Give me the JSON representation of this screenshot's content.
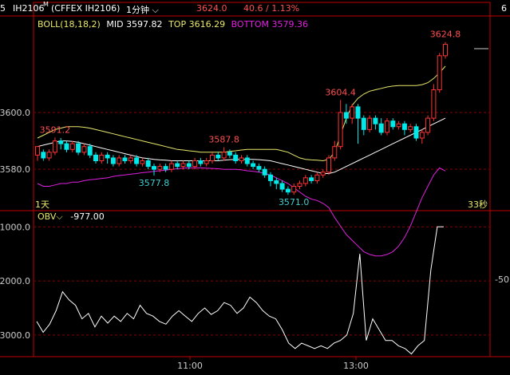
{
  "header": {
    "left_fragment": "5",
    "code": "IH2106",
    "superscript": "M",
    "exchange_label": "(CFFEX IH2106)",
    "period": "1分钟",
    "price": "3624.0",
    "change": "40.6 / 1.13%",
    "right_fragment": "6"
  },
  "boll": {
    "name": "BOLL(18,18,2)",
    "mid_label": "MID",
    "mid_value": "3597.82",
    "top_label": "TOP",
    "top_value": "3616.29",
    "bottom_label": "BOTTOM",
    "bottom_value": "3579.36"
  },
  "obv": {
    "name": "OBV",
    "value": "-977.00"
  },
  "markers": {
    "left_day": "1天",
    "right_seconds": "33秒",
    "right_fragment": "-50"
  },
  "colors": {
    "background": "#000000",
    "up": "#ff3232",
    "down": "#00e8e8",
    "mid_line": "#ffffff",
    "top_line": "#e8e86a",
    "bottom_line": "#e020e0",
    "grid": "#8b0000",
    "axis": "#c00000",
    "obv_line": "#ffffff",
    "price_label": "#ff5050",
    "low_label": "#40d0d0"
  },
  "chart_data": [
    {
      "type": "candlestick",
      "title": "IH2106 1分钟",
      "ylim": [
        3566,
        3634
      ],
      "y_ticks": [
        3580.0,
        3600.0
      ],
      "x_ticks": [
        "11:00",
        "13:00"
      ],
      "series": [
        {
          "name": "MID",
          "values": [
            3588.0,
            3588.5,
            3589.0,
            3589.5,
            3590.0,
            3590.0,
            3589.8,
            3589.5,
            3589.0,
            3588.5,
            3588.0,
            3587.5,
            3587.0,
            3586.5,
            3586.0,
            3585.5,
            3585.0,
            3584.5,
            3584.0,
            3583.8,
            3583.5,
            3583.3,
            3583.2,
            3583.0,
            3583.0,
            3583.0,
            3583.0,
            3583.0,
            3583.0,
            3583.0,
            3583.0,
            3583.0,
            3583.2,
            3583.4,
            3583.5,
            3583.5,
            3583.5,
            3583.5,
            3583.4,
            3583.2,
            3583.0,
            3582.5,
            3582.0,
            3581.5,
            3581.0,
            3580.5,
            3580.0,
            3579.5,
            3579.0,
            3578.5,
            3578.5,
            3579.0,
            3580.0,
            3581.0,
            3582.0,
            3583.0,
            3584.0,
            3585.0,
            3586.0,
            3587.0,
            3588.0,
            3589.0,
            3590.0,
            3591.0,
            3592.0,
            3593.0,
            3594.0,
            3595.0,
            3596.0,
            3597.0,
            3598.0
          ]
        },
        {
          "name": "TOP",
          "values": [
            3591.0,
            3592.0,
            3593.0,
            3594.0,
            3594.5,
            3595.0,
            3595.0,
            3595.0,
            3594.8,
            3594.5,
            3594.0,
            3593.5,
            3593.0,
            3592.5,
            3592.0,
            3591.5,
            3591.0,
            3590.5,
            3590.0,
            3589.5,
            3589.0,
            3588.5,
            3588.0,
            3587.5,
            3587.0,
            3586.8,
            3586.5,
            3586.3,
            3586.0,
            3586.0,
            3586.0,
            3586.0,
            3586.0,
            3586.3,
            3586.5,
            3586.8,
            3587.0,
            3587.0,
            3587.0,
            3587.0,
            3587.0,
            3587.0,
            3586.5,
            3586.0,
            3585.0,
            3584.0,
            3583.5,
            3583.3,
            3583.2,
            3583.0,
            3583.5,
            3586.0,
            3592.0,
            3598.0,
            3602.5,
            3605.0,
            3606.5,
            3607.5,
            3608.0,
            3608.5,
            3609.0,
            3609.3,
            3609.5,
            3609.5,
            3609.5,
            3609.5,
            3609.8,
            3610.5,
            3612.0,
            3614.0,
            3616.3
          ]
        },
        {
          "name": "BOTTOM",
          "values": [
            3575.0,
            3574.0,
            3574.0,
            3574.5,
            3575.0,
            3575.0,
            3575.5,
            3575.5,
            3576.0,
            3576.3,
            3576.5,
            3576.8,
            3577.0,
            3577.5,
            3577.8,
            3578.0,
            3578.3,
            3578.5,
            3578.8,
            3579.0,
            3579.3,
            3579.5,
            3579.7,
            3580.0,
            3580.2,
            3580.4,
            3580.5,
            3580.5,
            3580.5,
            3580.4,
            3580.3,
            3580.2,
            3580.0,
            3580.0,
            3580.0,
            3579.8,
            3579.5,
            3579.3,
            3579.0,
            3578.5,
            3578.0,
            3577.0,
            3576.0,
            3575.0,
            3573.5,
            3572.0,
            3570.5,
            3569.5,
            3569.0,
            3568.0,
            3566.5,
            3563.0,
            3560.0,
            3557.0,
            3555.0,
            3553.0,
            3551.0,
            3550.0,
            3549.5,
            3549.5,
            3550.0,
            3551.0,
            3553.0,
            3556.0,
            3560.0,
            3565.0,
            3570.0,
            3574.0,
            3578.0,
            3580.5,
            3579.4
          ]
        }
      ],
      "candles": [
        [
          3585,
          3588,
          3583,
          3586
        ],
        [
          3586,
          3584,
          3583,
          3587
        ],
        [
          3584,
          3586,
          3583,
          3587
        ],
        [
          3586,
          3590,
          3585,
          3591.2
        ],
        [
          3590,
          3589,
          3587,
          3591
        ],
        [
          3589,
          3587,
          3586,
          3590
        ],
        [
          3587,
          3589,
          3586,
          3590
        ],
        [
          3589,
          3586,
          3585,
          3590
        ],
        [
          3586,
          3588,
          3585,
          3589
        ],
        [
          3588,
          3585,
          3584,
          3589
        ],
        [
          3585,
          3583,
          3582,
          3586
        ],
        [
          3583,
          3585,
          3582,
          3586
        ],
        [
          3585,
          3584,
          3582,
          3586
        ],
        [
          3584,
          3582,
          3581,
          3585
        ],
        [
          3582,
          3584,
          3581,
          3585
        ],
        [
          3584,
          3583,
          3582,
          3585
        ],
        [
          3583,
          3584,
          3582,
          3585
        ],
        [
          3584,
          3582,
          3581,
          3585
        ],
        [
          3582,
          3583,
          3581,
          3584
        ],
        [
          3583,
          3581,
          3580,
          3584
        ],
        [
          3581,
          3580,
          3577.8,
          3582
        ],
        [
          3580,
          3581,
          3579,
          3582
        ],
        [
          3581,
          3580,
          3579,
          3582
        ],
        [
          3580,
          3582,
          3579,
          3583
        ],
        [
          3582,
          3581,
          3580,
          3583
        ],
        [
          3581,
          3582,
          3580,
          3583
        ],
        [
          3582,
          3581,
          3580,
          3583
        ],
        [
          3581,
          3583,
          3580,
          3584
        ],
        [
          3583,
          3582,
          3581,
          3584
        ],
        [
          3582,
          3583,
          3581,
          3584
        ],
        [
          3583,
          3585,
          3582,
          3586
        ],
        [
          3585,
          3584,
          3583,
          3586
        ],
        [
          3584,
          3586,
          3583,
          3587.8
        ],
        [
          3586,
          3585,
          3584,
          3587
        ],
        [
          3585,
          3583,
          3582,
          3586
        ],
        [
          3583,
          3584,
          3582,
          3585
        ],
        [
          3584,
          3582,
          3581,
          3585
        ],
        [
          3582,
          3581,
          3580,
          3583
        ],
        [
          3581,
          3580,
          3579,
          3582
        ],
        [
          3580,
          3578,
          3577,
          3581
        ],
        [
          3578,
          3576,
          3574,
          3579
        ],
        [
          3576,
          3575,
          3573,
          3577
        ],
        [
          3575,
          3573,
          3572,
          3576
        ],
        [
          3573,
          3572,
          3571.0,
          3574
        ],
        [
          3572,
          3574,
          3571,
          3575
        ],
        [
          3574,
          3575,
          3573,
          3576
        ],
        [
          3575,
          3577,
          3574,
          3578
        ],
        [
          3577,
          3576,
          3575,
          3578
        ],
        [
          3576,
          3578,
          3575,
          3579
        ],
        [
          3578,
          3579,
          3577,
          3580
        ],
        [
          3579,
          3584,
          3578,
          3585
        ],
        [
          3584,
          3588,
          3583,
          3590
        ],
        [
          3588,
          3600,
          3587,
          3604.4
        ],
        [
          3600,
          3598,
          3596,
          3603
        ],
        [
          3598,
          3602,
          3596,
          3603
        ],
        [
          3602,
          3598,
          3589,
          3603
        ],
        [
          3598,
          3594,
          3592,
          3599
        ],
        [
          3594,
          3598,
          3593,
          3599
        ],
        [
          3598,
          3596,
          3594,
          3599
        ],
        [
          3596,
          3593,
          3592,
          3598
        ],
        [
          3593,
          3597,
          3592,
          3598
        ],
        [
          3597,
          3595,
          3594,
          3598
        ],
        [
          3595,
          3596,
          3594,
          3597
        ],
        [
          3596,
          3594,
          3592,
          3597
        ],
        [
          3594,
          3595,
          3593,
          3596
        ],
        [
          3595,
          3591,
          3590,
          3596
        ],
        [
          3591,
          3593,
          3589,
          3594
        ],
        [
          3593,
          3598,
          3592,
          3599
        ],
        [
          3598,
          3608,
          3597,
          3610
        ],
        [
          3608,
          3620,
          3607,
          3621
        ],
        [
          3620,
          3624,
          3619,
          3624.8
        ]
      ],
      "annotations": [
        {
          "text": "3591.2",
          "value": 3591.2,
          "kind": "high"
        },
        {
          "text": "3577.8",
          "value": 3577.8,
          "kind": "low"
        },
        {
          "text": "3587.8",
          "value": 3587.8,
          "kind": "high"
        },
        {
          "text": "3571.0",
          "value": 3571.0,
          "kind": "low"
        },
        {
          "text": "3604.4",
          "value": 3604.4,
          "kind": "high"
        },
        {
          "text": "3624.8",
          "value": 3624.8,
          "kind": "high"
        }
      ]
    },
    {
      "type": "line",
      "title": "OBV",
      "ylim": [
        -3400,
        -700
      ],
      "y_ticks": [
        -1000.0,
        -2000.0,
        -3000.0
      ],
      "series": [
        {
          "name": "OBV",
          "values": [
            -2750,
            -2950,
            -2800,
            -2550,
            -2200,
            -2350,
            -2450,
            -2700,
            -2600,
            -2850,
            -2650,
            -2780,
            -2650,
            -2750,
            -2600,
            -2700,
            -2450,
            -2600,
            -2650,
            -2750,
            -2800,
            -2650,
            -2550,
            -2650,
            -2750,
            -2600,
            -2500,
            -2620,
            -2550,
            -2400,
            -2450,
            -2600,
            -2500,
            -2300,
            -2400,
            -2550,
            -2650,
            -2700,
            -2900,
            -3150,
            -3250,
            -3150,
            -3200,
            -3250,
            -3200,
            -3250,
            -3150,
            -3100,
            -3000,
            -2600,
            -1500,
            -3100,
            -2700,
            -2900,
            -3100,
            -3100,
            -3200,
            -3250,
            -3350,
            -3200,
            -3100,
            -1800,
            -1000,
            -1000
          ]
        }
      ]
    }
  ]
}
